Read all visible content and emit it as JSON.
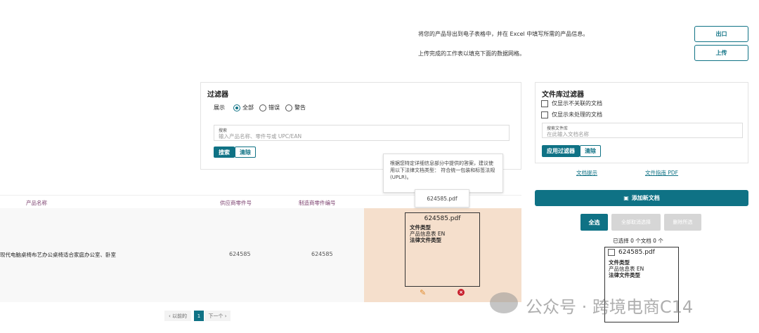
{
  "top": {
    "export_text": "将您的产品导出到电子表格中，并在 Excel 中填写所需的产品信息。",
    "upload_text": "上传完成的工作表以填充下面的数据网格。",
    "export_button": "出口",
    "upload_button": "上传"
  },
  "filter": {
    "title": "过滤器",
    "show_label": "展示",
    "options": [
      "全部",
      "错误",
      "警告"
    ],
    "selected": "全部",
    "search_label": "搜索",
    "search_placeholder": "输入产品名称、零件号或 UPC/EAN",
    "search_button": "搜索",
    "clear_button": "清除"
  },
  "library": {
    "title": "文件库过滤器",
    "checkbox1": "仅显示不关联的文档",
    "checkbox2": "仅显示未处理的文档",
    "search_label": "搜索文件库",
    "search_placeholder": "在此输入文档名称",
    "apply_button": "应用过滤器",
    "clear_button": "清除",
    "link1": "文档提示",
    "link2": "文件指南 PDF",
    "add_button": "添加新文档",
    "select_all": "全选",
    "deselect_all": "全部取消选择",
    "delete_selected": "删除所选",
    "selected_text": "已选择 0 个文档 0 个"
  },
  "tooltip": {
    "text": "根据您特定详细信息部分中提供的答案，建议使用以下法律文档类型： 符合统一包装和标签法规 (UPLR)。",
    "file_tip": "624585.pdf"
  },
  "table": {
    "headers": [
      "产品名称",
      "供应商零件号",
      "制造商零件编号"
    ],
    "rows": [
      {
        "name": "现代电脑桌椅布艺办公桌椅适合家庭办公室、卧室",
        "supplier_pn": "624585",
        "mfr_pn": "624585"
      }
    ]
  },
  "doc": {
    "filename": "624585.pdf",
    "type_label": "文件类型",
    "type_value": "产品信息表 EN",
    "legal_label": "法律文件类型"
  },
  "pagination": {
    "prev": "‹ 以前的",
    "current": "1",
    "next": "下一个 ›"
  },
  "watermark": "公众号 · 跨境电商C14",
  "colors": {
    "accent": "#0f7285",
    "peach": "#f5dfcc",
    "header": "#7b3f6e"
  }
}
